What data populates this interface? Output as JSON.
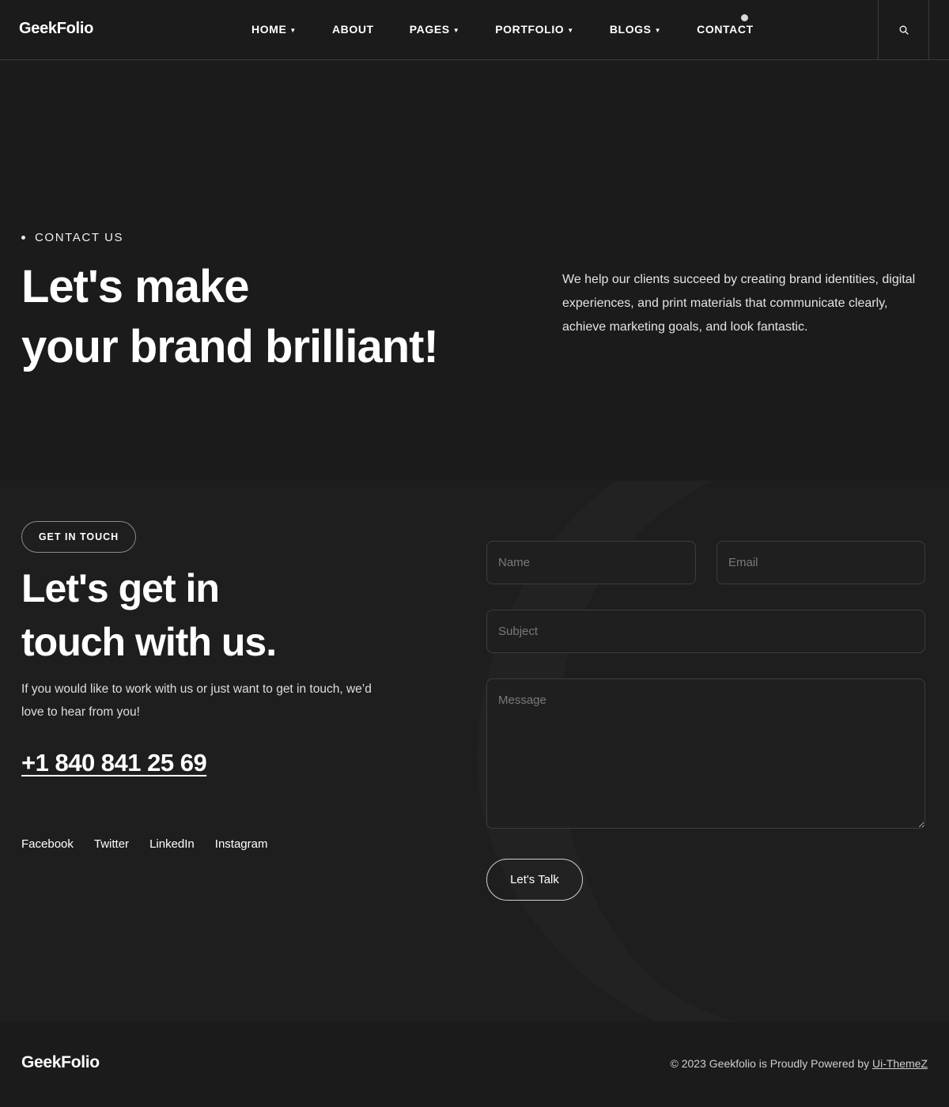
{
  "header": {
    "logo": "GeekFolio",
    "nav": [
      {
        "label": "HOME",
        "has_dropdown": true
      },
      {
        "label": "ABOUT",
        "has_dropdown": false
      },
      {
        "label": "PAGES",
        "has_dropdown": true
      },
      {
        "label": "PORTFOLIO",
        "has_dropdown": true
      },
      {
        "label": "BLOGS",
        "has_dropdown": true
      },
      {
        "label": "CONTACT",
        "has_dropdown": false
      }
    ],
    "caret": "▼",
    "search_icon": "search-icon"
  },
  "hero": {
    "eyebrow": "CONTACT US",
    "title_line1": "Let's make",
    "title_line2": "your brand brilliant!",
    "description": "We help our clients succeed by creating brand identities, digital experiences, and print materials that communicate clearly, achieve marketing goals, and look fantastic."
  },
  "contact": {
    "pill_label": "GET IN TOUCH",
    "title_line1": "Let's get in",
    "title_line2": "touch with us.",
    "description": "If you would like to work with us or just want to get in touch, we’d love to hear from you!",
    "phone": "+1 840 841 25 69",
    "socials": [
      "Facebook",
      "Twitter",
      "LinkedIn",
      "Instagram"
    ],
    "form": {
      "name_placeholder": "Name",
      "email_placeholder": "Email",
      "subject_placeholder": "Subject",
      "message_placeholder": "Message",
      "name_value": "",
      "email_value": "",
      "subject_value": "",
      "message_value": "",
      "submit_label": "Let's Talk"
    }
  },
  "footer": {
    "logo": "GeekFolio",
    "copyright_prefix": "© 2023 Geekfolio is Proudly Powered by ",
    "copyright_link": "Ui-ThemeZ"
  },
  "colors": {
    "background": "#1b1b1b",
    "section_background": "#1e1e1e",
    "text": "#ffffff",
    "border": "#3c3c3c"
  }
}
